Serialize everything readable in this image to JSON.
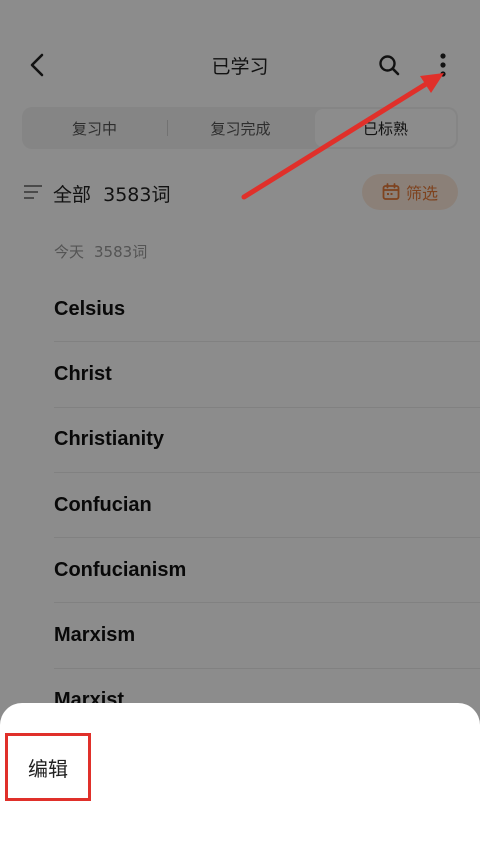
{
  "header": {
    "title": "已学习"
  },
  "tabs": [
    {
      "label": "复习中",
      "active": false
    },
    {
      "label": "复习完成",
      "active": false
    },
    {
      "label": "已标熟",
      "active": true
    }
  ],
  "filter": {
    "all_text": "全部",
    "count_text": "3583词",
    "filter_label": "筛选"
  },
  "group": {
    "day": "今天",
    "count": "3583词"
  },
  "words": [
    "Celsius",
    "Christ",
    "Christianity",
    "Confucian",
    "Confucianism",
    "Marxism",
    "Marxist"
  ],
  "sheet": {
    "edit_label": "编辑"
  },
  "colors": {
    "accent": "#e57a3a",
    "annotation": "#e0302a"
  }
}
